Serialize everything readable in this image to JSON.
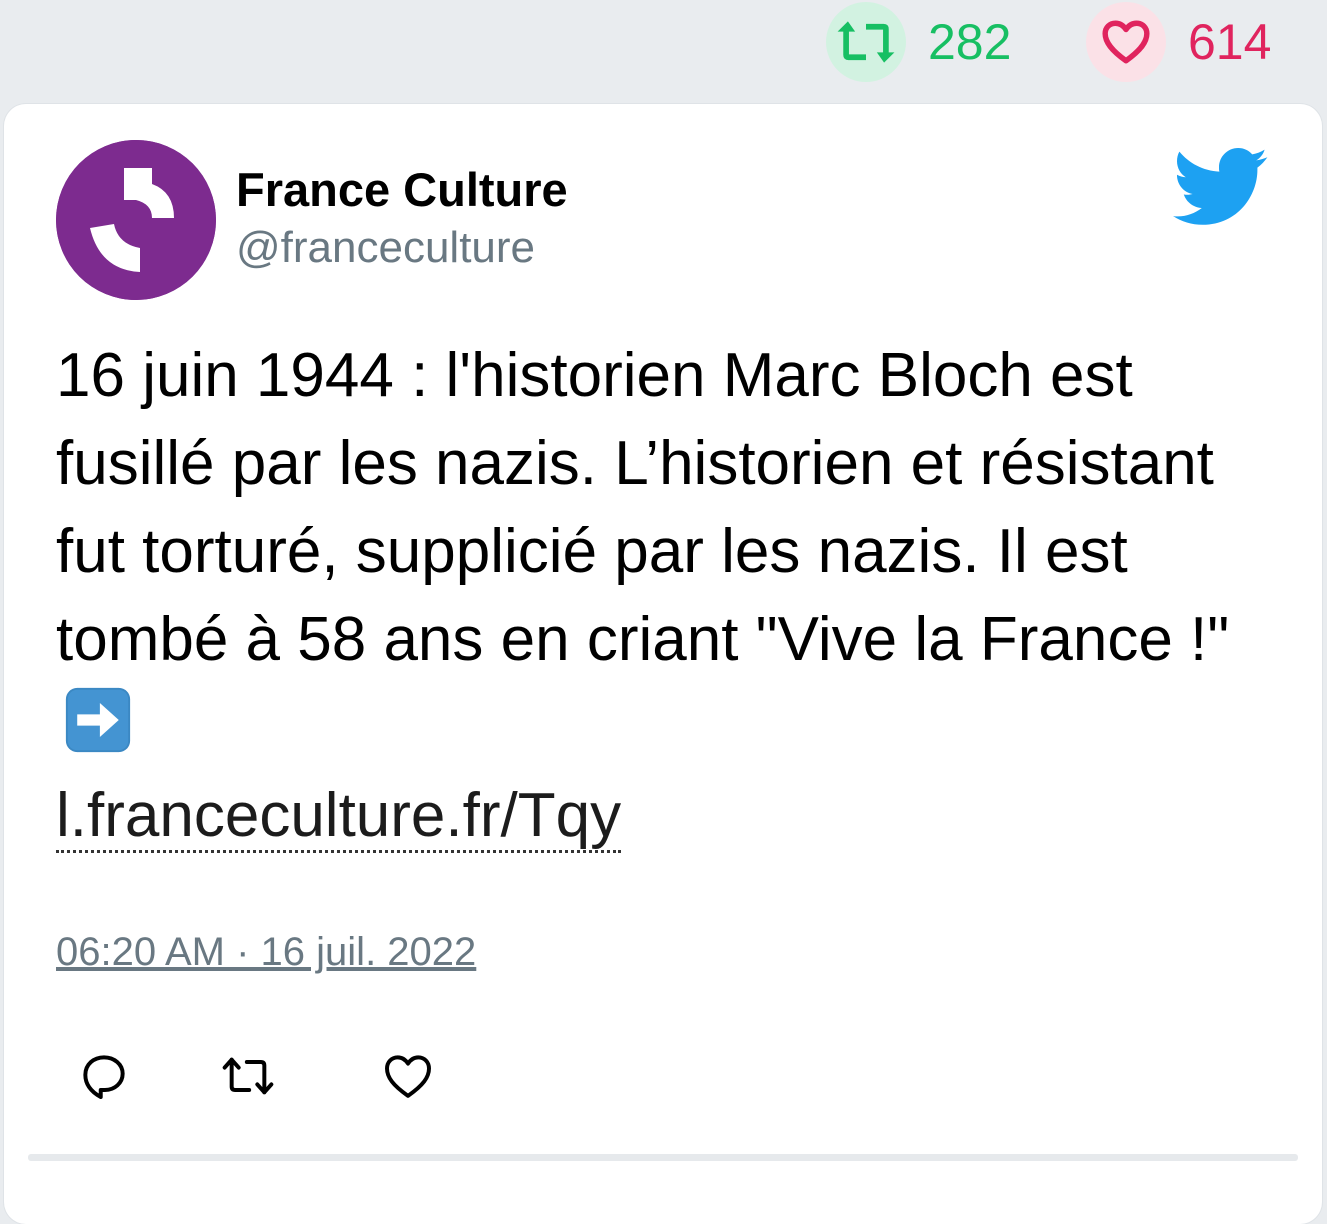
{
  "stats": {
    "retweet_count": "282",
    "like_count": "614",
    "retweet_color": "#17bf63",
    "like_color": "#e0245e"
  },
  "tweet": {
    "author_name": "France Culture",
    "author_handle": "@franceculture",
    "text_main": "16 juin 1944 : l'historien Marc Bloch est fusillé par les nazis. L’historien et résistant fut torturé, supplicié par les nazis. Il est tombé à 58 ans en criant \"Vive la France !\"",
    "emoji": "arrow-right-emoji",
    "link": "l.franceculture.fr/Tqy",
    "timestamp": "06:20 AM · 16 juil. 2022"
  },
  "icons": {
    "avatar": "france-culture-logo",
    "brand": "twitter-bird-icon",
    "actions": [
      "reply-icon",
      "retweet-icon",
      "like-icon"
    ]
  },
  "colors": {
    "avatar_bg": "#7d2b8f",
    "twitter_blue": "#1da1f2",
    "muted_text": "#697882"
  }
}
